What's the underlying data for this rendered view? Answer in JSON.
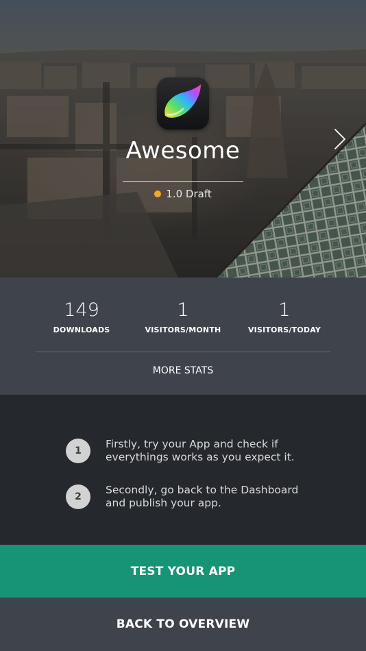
{
  "app": {
    "name": "Awesome",
    "version": "1.0 Draft",
    "status_color": "#f5a623"
  },
  "icons": {
    "app_icon": "brush-stroke-icon",
    "next": "chevron-right-icon"
  },
  "stats": {
    "items": [
      {
        "value": "149",
        "label": "DOWNLOADS"
      },
      {
        "value": "1",
        "label": "VISITORS/MONTH"
      },
      {
        "value": "1",
        "label": "VISITORS/TODAY"
      }
    ],
    "more_label": "MORE STATS"
  },
  "steps": [
    {
      "number": "1",
      "text": "Firstly, try your App and check if everythings works as you expect it."
    },
    {
      "number": "2",
      "text": "Secondly, go back to the Dashboard and publish your app."
    }
  ],
  "actions": {
    "test_label": "TEST YOUR APP",
    "back_label": "BACK TO OVERVIEW"
  },
  "colors": {
    "accent": "#169475",
    "panel": "#3f444c",
    "dark_panel": "#25282d"
  }
}
